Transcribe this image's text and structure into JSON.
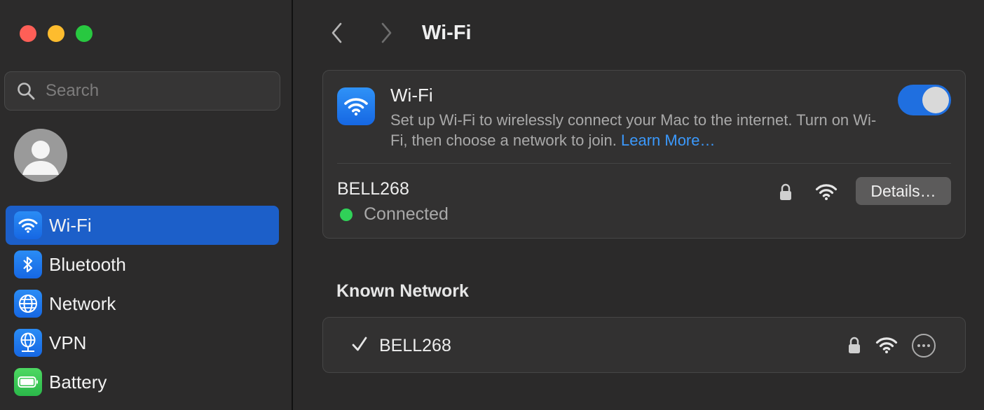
{
  "window_controls": [
    "close",
    "minimize",
    "maximize"
  ],
  "search": {
    "placeholder": "Search",
    "icon": "search-icon"
  },
  "sidebar": {
    "items": [
      {
        "label": "Wi-Fi",
        "icon": "wifi-icon",
        "active": true
      },
      {
        "label": "Bluetooth",
        "icon": "bluetooth-icon",
        "active": false
      },
      {
        "label": "Network",
        "icon": "globe-icon",
        "active": false
      },
      {
        "label": "VPN",
        "icon": "vpn-globe-icon",
        "active": false
      },
      {
        "label": "Battery",
        "icon": "battery-icon",
        "active": false
      }
    ]
  },
  "toolbar": {
    "title": "Wi-Fi"
  },
  "wifi_card": {
    "heading": "Wi-Fi",
    "description": "Set up Wi-Fi to wirelessly connect your Mac to the internet. Turn on Wi-Fi, then choose a network to join.",
    "learn_more": "Learn More…",
    "enabled": true,
    "current_network": {
      "name": "BELL268",
      "status": "Connected",
      "status_color": "#30d158",
      "secured": true
    },
    "details_label": "Details…"
  },
  "known_networks": {
    "title": "Known Network",
    "items": [
      {
        "name": "BELL268",
        "checked": true,
        "secured": true
      }
    ]
  },
  "colors": {
    "accent": "#1c5fc9",
    "link": "#3b99fc"
  }
}
